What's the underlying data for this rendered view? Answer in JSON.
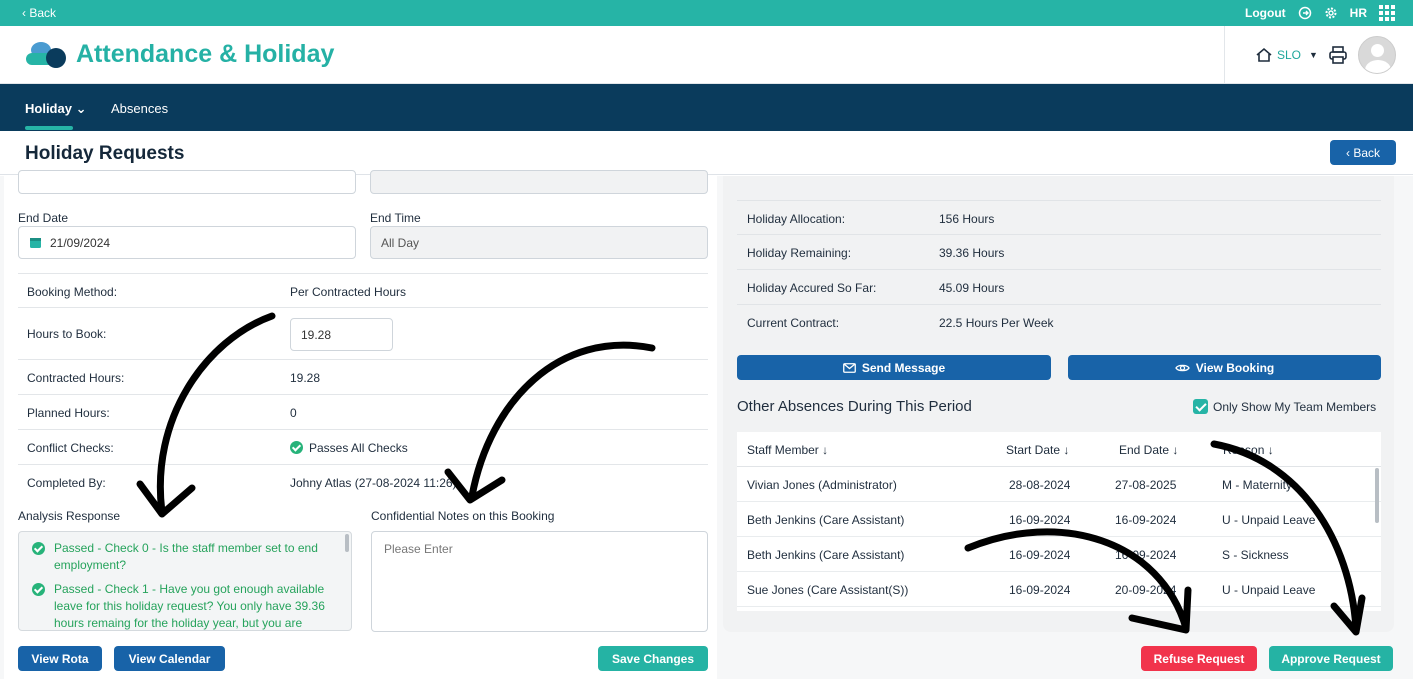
{
  "topbar": {
    "back_label": "‹ Back",
    "logout_label": "Logout",
    "user_initials": "HR"
  },
  "header": {
    "app_title": "Attendance & Holiday",
    "site_label": "SLO"
  },
  "nav": {
    "tabs": [
      {
        "label": "Holiday",
        "active": true
      },
      {
        "label": "Absences",
        "active": false
      }
    ]
  },
  "page": {
    "title": "Holiday Requests",
    "back_button": "‹ Back"
  },
  "form": {
    "end_date_label": "End Date",
    "end_date_value": "21/09/2024",
    "end_time_label": "End Time",
    "end_time_value": "All Day",
    "rows": [
      {
        "key": "Booking Method:",
        "value": "Per Contracted Hours"
      },
      {
        "key": "Hours to Book:",
        "value": "19.28"
      },
      {
        "key": "Contracted Hours:",
        "value": "19.28"
      },
      {
        "key": "Planned Hours:",
        "value": "0"
      },
      {
        "key": "Conflict Checks:",
        "value": "Passes All Checks"
      },
      {
        "key": "Completed By:",
        "value": "Johny Atlas (27-08-2024 11:26)"
      }
    ],
    "analysis_label": "Analysis Response",
    "analysis_items": [
      {
        "status": "Passed - Check 0",
        "text": " - Is the staff member set to end employment?"
      },
      {
        "status": "Passed - Check 1",
        "text": " - Have you got enough available leave for this holiday request? You only have 39.36 hours remaing for the holiday year, but you are"
      }
    ],
    "notes_label": "Confidential Notes on this Booking",
    "notes_placeholder": "Please Enter",
    "buttons": {
      "view_rota": "View Rota",
      "view_calendar": "View Calendar",
      "save_changes": "Save Changes"
    }
  },
  "summary": {
    "rows": [
      {
        "key": "Holiday Allocation:",
        "value": "156 Hours"
      },
      {
        "key": "Holiday Remaining:",
        "value": "39.36 Hours"
      },
      {
        "key": "Holiday Accured So Far:",
        "value": "45.09 Hours"
      },
      {
        "key": "Current Contract:",
        "value": "22.5 Hours Per Week"
      }
    ],
    "send_message": "Send Message",
    "view_booking": "View Booking",
    "other_absences_title": "Other Absences During This Period",
    "team_only_label": "Only Show My Team Members",
    "team_only_checked": true
  },
  "absences_table": {
    "headers": [
      "Staff Member ↓",
      "Start Date ↓",
      "End Date ↓",
      "Reason ↓"
    ],
    "rows": [
      {
        "staff": "Vivian Jones (Administrator)",
        "start": "28-08-2024",
        "end": "27-08-2025",
        "reason": "M - Maternity"
      },
      {
        "staff": "Beth Jenkins (Care Assistant)",
        "start": "16-09-2024",
        "end": "16-09-2024",
        "reason": "U - Unpaid Leave"
      },
      {
        "staff": "Beth Jenkins (Care Assistant)",
        "start": "16-09-2024",
        "end": "16-09-2024",
        "reason": "S - Sickness"
      },
      {
        "staff": "Sue Jones (Care Assistant(S))",
        "start": "16-09-2024",
        "end": "20-09-2024",
        "reason": "U - Unpaid Leave"
      }
    ]
  },
  "actions": {
    "refuse": "Refuse Request",
    "approve": "Approve Request"
  },
  "colors": {
    "teal": "#26b4a6",
    "navy": "#0a3b5c",
    "blue": "#1863a8",
    "red": "#f1344c",
    "success": "#27b37a"
  }
}
